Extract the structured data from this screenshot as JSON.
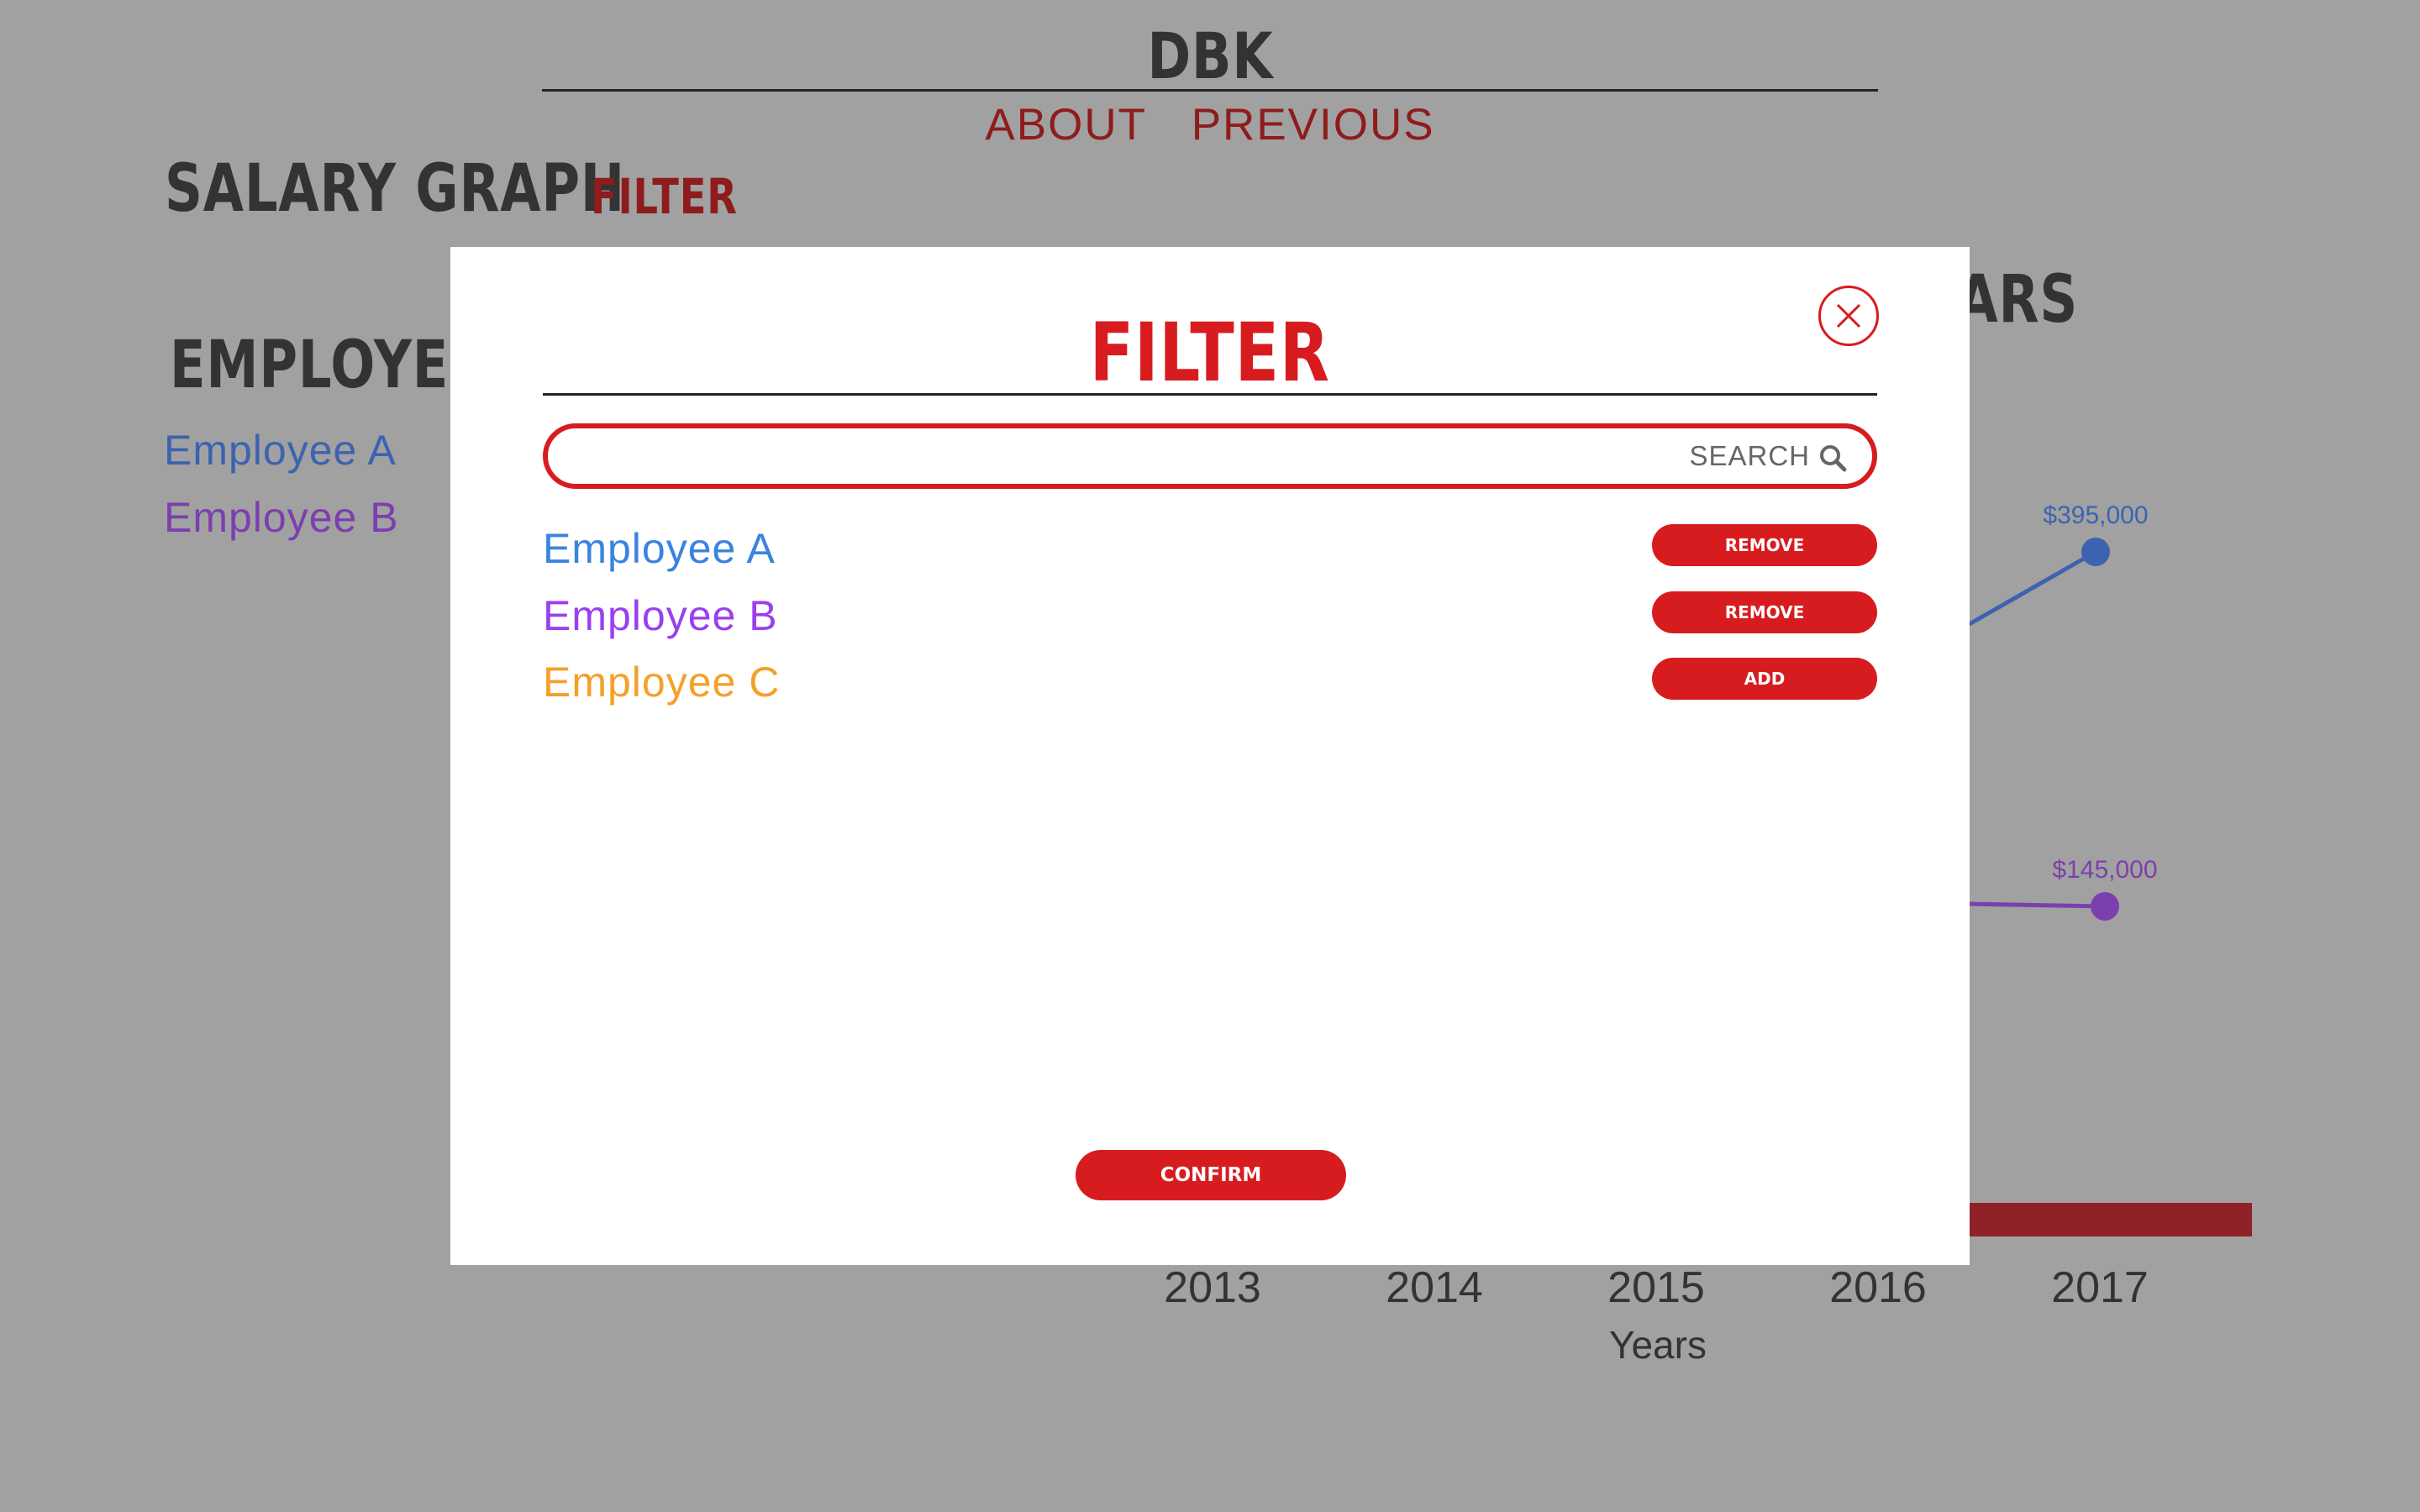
{
  "header": {
    "brand": "DBK",
    "nav": [
      "ABOUT",
      "PREVIOUS"
    ]
  },
  "page": {
    "title": "SALARY GRAPH",
    "filter_link": "FILTER",
    "employees_heading": "EMPLOYEES",
    "years_heading": "YEARS"
  },
  "legend": [
    {
      "label": "Employee A",
      "color": "#3d63b0"
    },
    {
      "label": "Employee B",
      "color": "#7c3fae"
    }
  ],
  "chart_data": {
    "type": "line",
    "x": [
      2013,
      2014,
      2015,
      2016,
      2017
    ],
    "xlabel": "Years",
    "series": [
      {
        "name": "Employee A",
        "color": "#3d63b0",
        "visible_points": [
          {
            "x": 2017,
            "y": 395000,
            "label": "$395,000"
          }
        ]
      },
      {
        "name": "Employee B",
        "color": "#7c3fae",
        "visible_points": [
          {
            "x": 2017,
            "y": 145000,
            "label": "$145,000"
          }
        ]
      }
    ]
  },
  "modal": {
    "title": "FILTER",
    "close_icon": "close-icon",
    "search": {
      "value": "",
      "placeholder": "",
      "label": "SEARCH",
      "icon": "search-icon"
    },
    "employees": [
      {
        "name": "Employee A",
        "color": "#3b83e0",
        "action": "REMOVE"
      },
      {
        "name": "Employee B",
        "color": "#9a3ff0",
        "action": "REMOVE"
      },
      {
        "name": "Employee C",
        "color": "#f5a028",
        "action": "ADD"
      }
    ],
    "confirm_label": "CONFIRM"
  },
  "colors": {
    "accent": "#d71c1f",
    "dark_red": "#8e1c1c",
    "overlay": "#a1a1a1"
  }
}
